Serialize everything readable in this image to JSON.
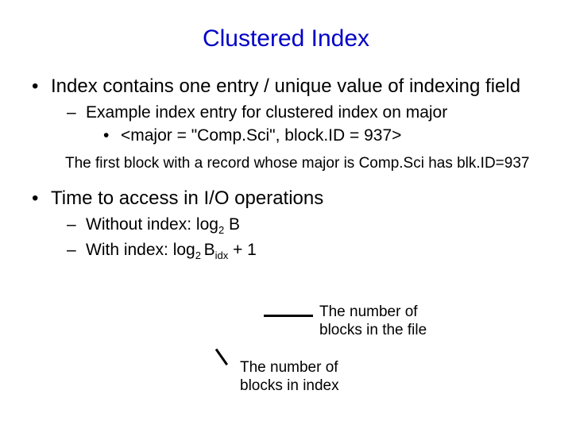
{
  "title": "Clustered Index",
  "bullets": {
    "b1": "Index contains one entry / unique value of indexing field",
    "b1_1": "Example index entry for clustered index on major",
    "b1_1_1": "<major = \"Comp.Sci\", block.ID = 937>",
    "aside1": "The first block with a record whose major is Comp.Sci has blk.ID=937",
    "b2": "Time to access in I/O operations",
    "b2_1_pre": "Without index: log",
    "b2_1_sub": "2",
    "b2_1_post": " B",
    "b2_2_pre": "With index: log",
    "b2_2_sub": "2 ",
    "b2_2_mid": "B",
    "b2_2_sub2": "idx",
    "b2_2_post": " + 1"
  },
  "annot": {
    "a1": "The number of blocks in the file",
    "a2": "The number of blocks in index"
  }
}
